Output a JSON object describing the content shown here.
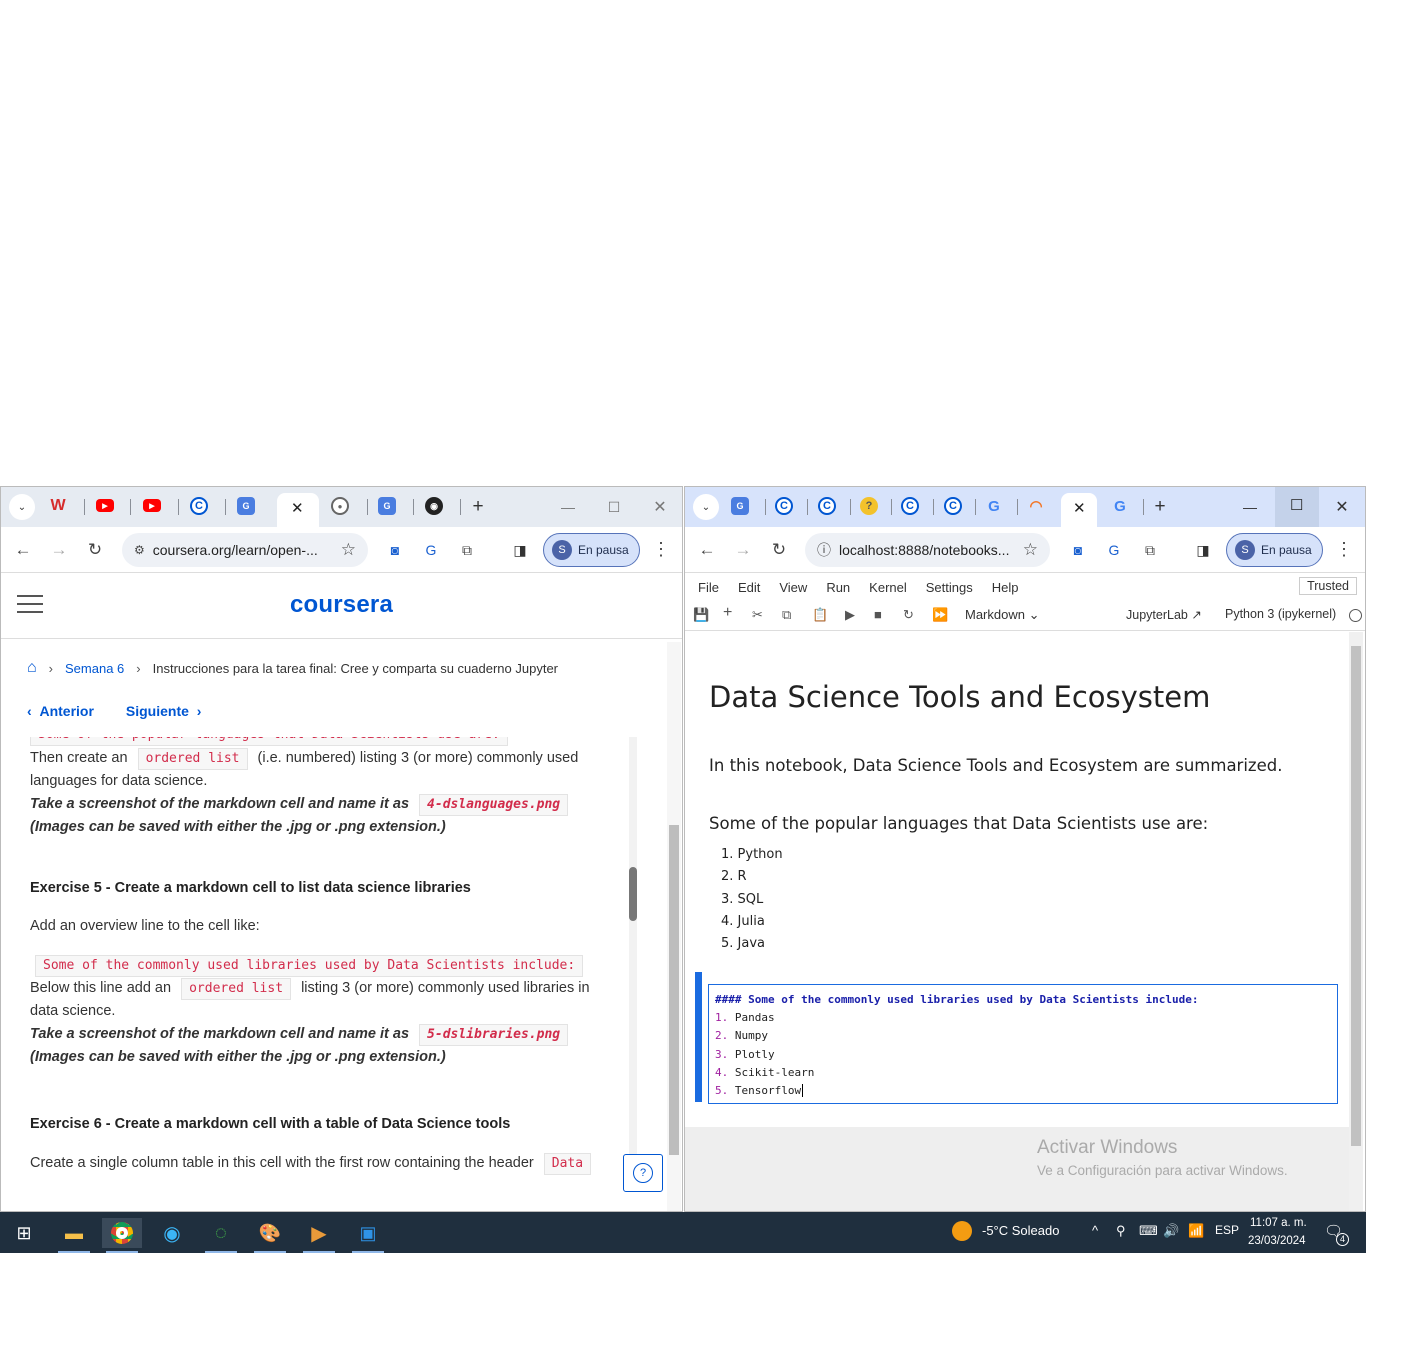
{
  "left_window": {
    "tabs": [
      {
        "icon": "w",
        "color": "#d62c2c"
      },
      {
        "icon": "youtube",
        "color": "#ff0000"
      },
      {
        "icon": "youtube",
        "color": "#ff0000"
      },
      {
        "icon": "coursera-c",
        "color": "#0056d2"
      },
      {
        "icon": "translate",
        "color": "#4a7de0"
      },
      {
        "icon": "active-close",
        "color": "#333"
      },
      {
        "icon": "globe",
        "color": "#666"
      },
      {
        "icon": "translate",
        "color": "#4a7de0"
      },
      {
        "icon": "github",
        "color": "#222"
      }
    ],
    "url": "coursera.org/learn/open-...",
    "profile_initial": "S",
    "profile_status": "En pausa",
    "logo": "coursera",
    "breadcrumb": {
      "level1": "Semana 6",
      "level2": "Instrucciones para la tarea final: Cree y comparta su cuaderno Jupyter"
    },
    "nav": {
      "prev": "Anterior",
      "next": "Siguiente"
    },
    "content": {
      "cut_code": "Some of the popular languages that Data Scientists use are:",
      "p1_before": "Then create an",
      "p1_code": "ordered list",
      "p1_after": "(i.e. numbered) listing 3 (or more) commonly used",
      "p1_line2": "languages for data science.",
      "p2_text": "Take a screenshot of the markdown cell and name it as",
      "p2_code": "4-dslanguages.png",
      "p3_text": "(Images can be saved with either the .jpg or .png extension.)",
      "ex5_title": "Exercise 5 - Create a markdown cell to list data science libraries",
      "ex5_intro": "Add an overview line to the cell like:",
      "ex5_code": "Some of the commonly used libraries used by Data Scientists include:",
      "ex5_before": "Below this line add an",
      "ex5_code2": "ordered list",
      "ex5_after": "listing 3 (or more) commonly used libraries in",
      "ex5_line2": "data science.",
      "ex5_shot": "Take a screenshot of the markdown cell and name it as",
      "ex5_file": "5-dslibraries.png",
      "ex5_ext": "(Images can be saved with either the .jpg or .png extension.)",
      "ex6_title": "Exercise 6 - Create a markdown cell with a table of Data Science tools",
      "ex6_text": "Create a single column table in this cell with the first row containing the header",
      "ex6_code": "Data"
    },
    "help_label": "?"
  },
  "right_window": {
    "url": "localhost:8888/notebooks...",
    "profile_initial": "S",
    "profile_status": "En pausa",
    "menu": [
      "File",
      "Edit",
      "View",
      "Run",
      "Kernel",
      "Settings",
      "Help"
    ],
    "trusted": "Trusted",
    "cell_type": "Markdown",
    "jupyterlab_link": "JupyterLab",
    "kernel": "Python 3 (ipykernel)",
    "notebook": {
      "title": "Data Science Tools and Ecosystem",
      "intro": "In this notebook, Data Science Tools and Ecosystem are summarized.",
      "languages_heading": "Some of the popular languages that Data Scientists use are:",
      "languages": [
        "1. Python",
        "2. R",
        "3. SQL",
        "4. Julia",
        "5. Java"
      ],
      "editor_heading": "#### Some of the commonly used libraries used by Data Scientists include:",
      "editor_items": [
        {
          "num": "1.",
          "text": "Pandas"
        },
        {
          "num": "2.",
          "text": "Numpy"
        },
        {
          "num": "3.",
          "text": "Plotly"
        },
        {
          "num": "4.",
          "text": "Scikit-learn"
        },
        {
          "num": "5.",
          "text": "Tensorflow"
        }
      ]
    },
    "watermark_title": "Activar Windows",
    "watermark_sub": "Ve a Configuración para activar Windows."
  },
  "taskbar": {
    "weather": "-5°C  Soleado",
    "language": "ESP",
    "time": "11:07 a. m.",
    "date": "23/03/2024",
    "notifications": "4"
  }
}
